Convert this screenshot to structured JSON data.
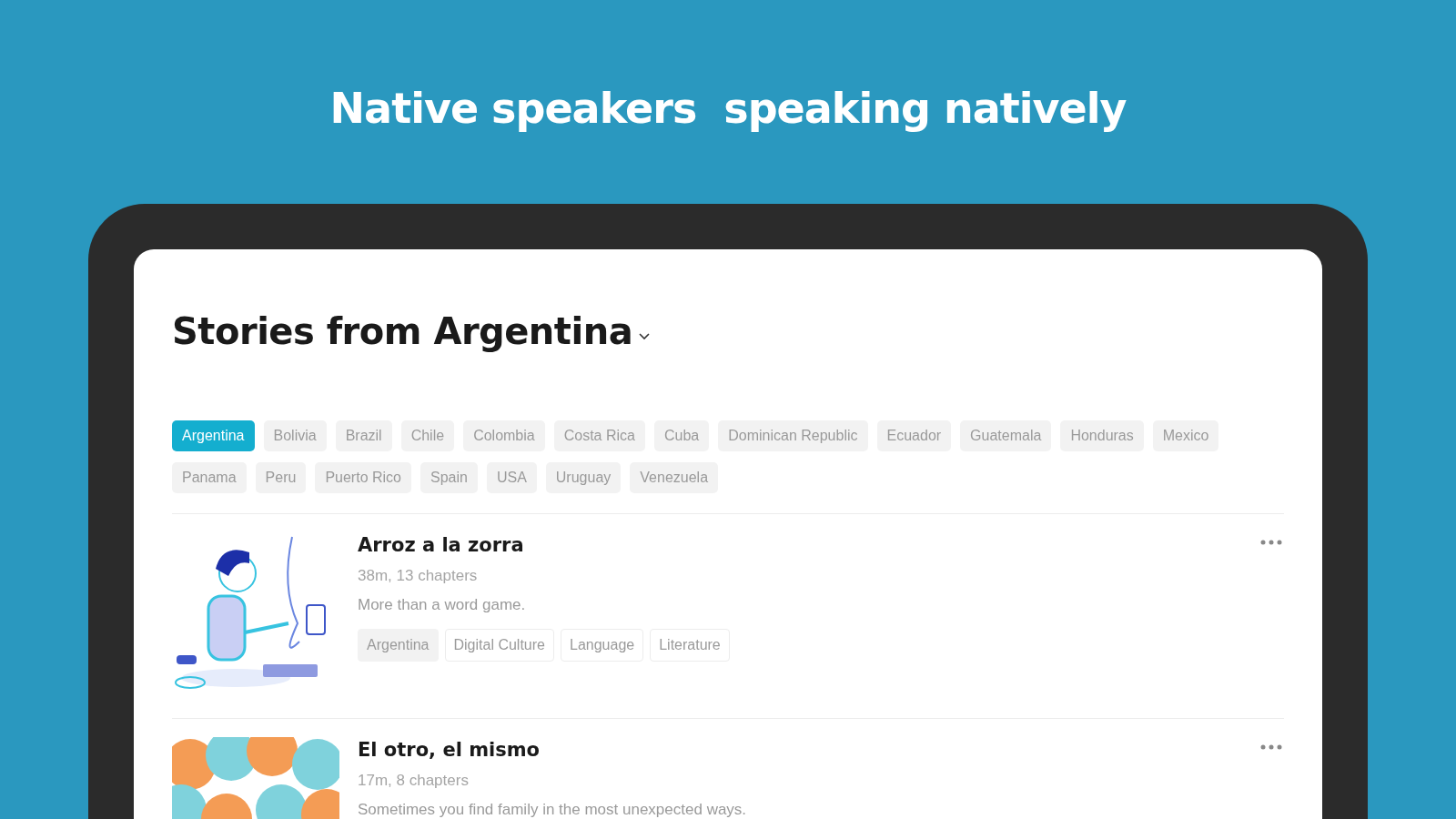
{
  "headline": "Native speakers  speaking natively",
  "page_title": "Stories from Argentina",
  "countries": [
    {
      "label": "Argentina",
      "selected": true
    },
    {
      "label": "Bolivia",
      "selected": false
    },
    {
      "label": "Brazil",
      "selected": false
    },
    {
      "label": "Chile",
      "selected": false
    },
    {
      "label": "Colombia",
      "selected": false
    },
    {
      "label": "Costa Rica",
      "selected": false
    },
    {
      "label": "Cuba",
      "selected": false
    },
    {
      "label": "Dominican Republic",
      "selected": false
    },
    {
      "label": "Ecuador",
      "selected": false
    },
    {
      "label": "Guatemala",
      "selected": false
    },
    {
      "label": "Honduras",
      "selected": false
    },
    {
      "label": "Mexico",
      "selected": false
    },
    {
      "label": "Panama",
      "selected": false
    },
    {
      "label": "Peru",
      "selected": false
    },
    {
      "label": "Puerto Rico",
      "selected": false
    },
    {
      "label": "Spain",
      "selected": false
    },
    {
      "label": "USA",
      "selected": false
    },
    {
      "label": "Uruguay",
      "selected": false
    },
    {
      "label": "Venezuela",
      "selected": false
    }
  ],
  "stories": [
    {
      "title": "Arroz a la zorra",
      "meta": "38m, 13 chapters",
      "description": "More than a word game.",
      "tags": [
        {
          "label": "Argentina",
          "kind": "filled"
        },
        {
          "label": "Digital Culture",
          "kind": "outline"
        },
        {
          "label": "Language",
          "kind": "outline"
        },
        {
          "label": "Literature",
          "kind": "outline"
        }
      ]
    },
    {
      "title": "El otro, el mismo",
      "meta": "17m, 8 chapters",
      "description": "Sometimes you find family in the most unexpected ways."
    }
  ]
}
